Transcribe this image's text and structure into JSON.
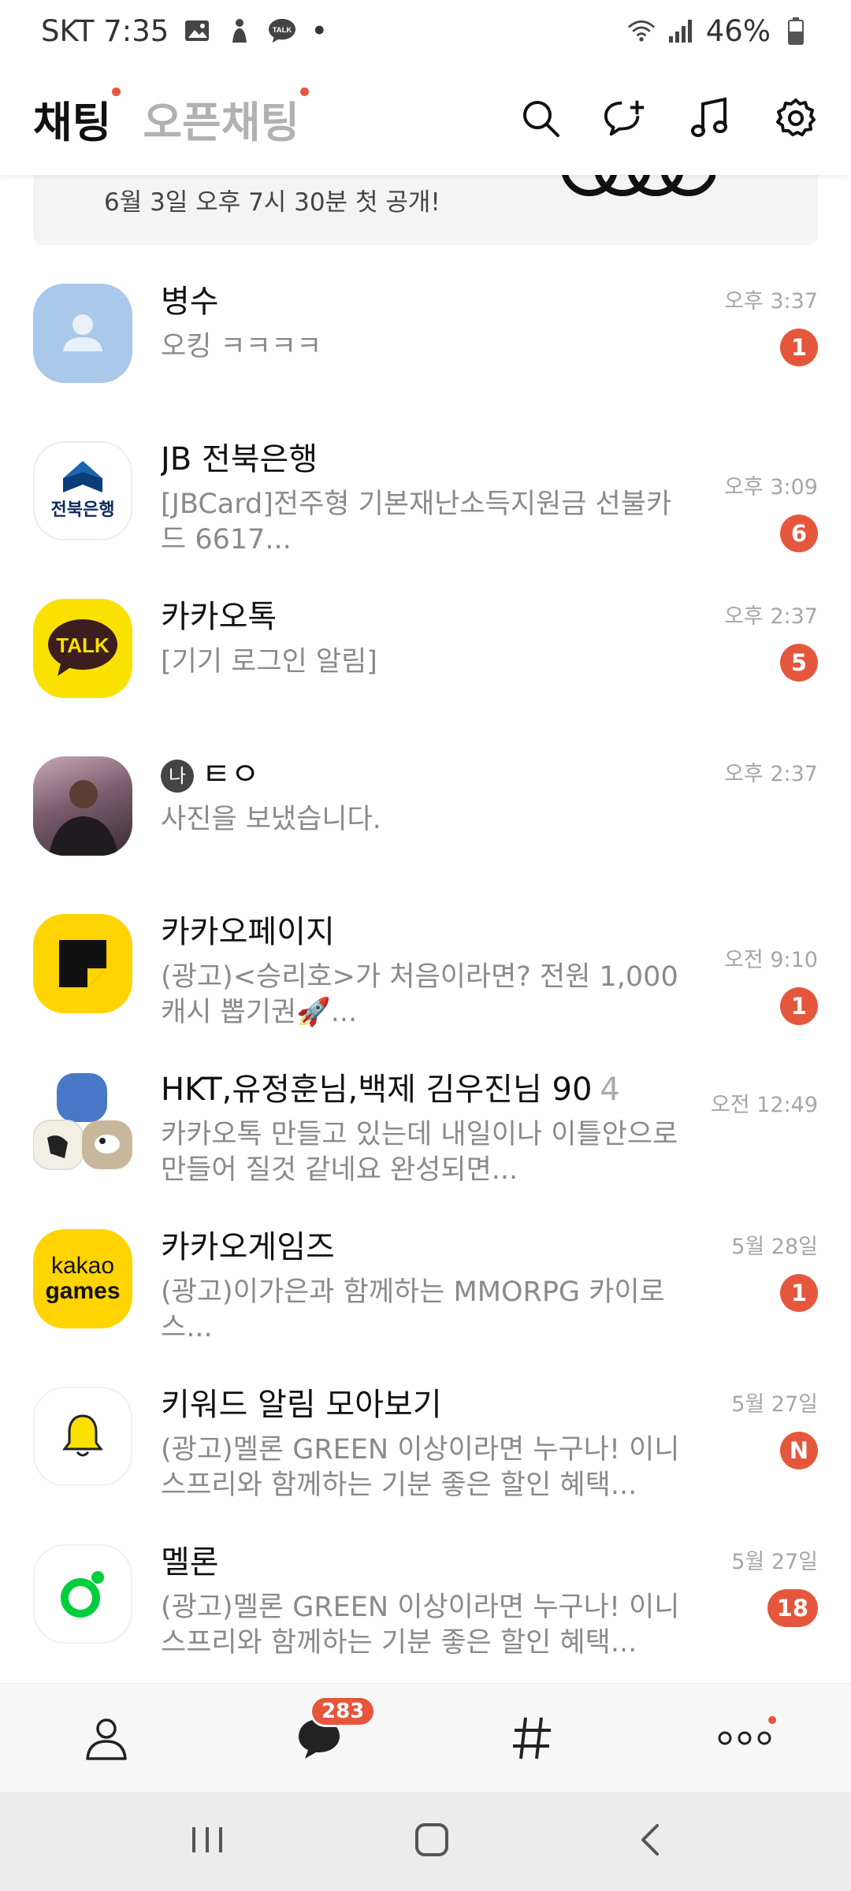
{
  "status_bar": {
    "carrier_time": "SKT 7:35",
    "notif_talk": "TALK",
    "dot": "•",
    "battery": "46%"
  },
  "header": {
    "tabs": [
      {
        "label": "채팅",
        "active": true
      },
      {
        "label": "오픈채팅",
        "active": false
      }
    ],
    "icons": [
      "search-icon",
      "new-chat-icon",
      "music-icon",
      "settings-icon"
    ]
  },
  "banner": {
    "text": "6월 3일 오후 7시 30분 첫 공개!"
  },
  "chats": [
    {
      "name": "병수",
      "count": "",
      "preview": "오킹 ㅋㅋㅋㅋ",
      "time": "오후 3:37",
      "badge": "1"
    },
    {
      "name": "JB 전북은행",
      "count": "",
      "preview": "[JBCard]전주형 기본재난소득지원금 선불카드 6617...",
      "time": "오후 3:09",
      "badge": "6",
      "avatar_text": "전북은행"
    },
    {
      "name": "카카오톡",
      "count": "",
      "preview": "[기기 로그인 알림]",
      "time": "오후 2:37",
      "badge": "5",
      "avatar_text": "TALK"
    },
    {
      "name": "ㅌㅇ",
      "count": "",
      "preview": "사진을 보냈습니다.",
      "time": "오후 2:37",
      "badge": "",
      "prefix": "나"
    },
    {
      "name": "카카오페이지",
      "count": "",
      "preview": "(광고)<승리호>가 처음이라면? 전원 1,000캐시 뽑기권🚀...",
      "time": "오전 9:10",
      "badge": "1"
    },
    {
      "name": "HKT,유정훈님,백제 김우진님 90",
      "count": "4",
      "preview": "카카오톡 만들고 있는데 내일이나 이틀안으로 만들어 질것 같네요 완성되면...",
      "time": "오전 12:49",
      "badge": ""
    },
    {
      "name": "카카오게임즈",
      "count": "",
      "preview": "(광고)이가은과 함께하는 MMORPG 카이로스...",
      "time": "5월 28일",
      "badge": "1",
      "avatar_text_1": "kakao",
      "avatar_text_2": "games"
    },
    {
      "name": "키워드 알림 모아보기",
      "count": "",
      "preview": "(광고)멜론 GREEN 이상이라면 누구나! 이니스프리와 함께하는 기분 좋은 할인 혜택...",
      "time": "5월 27일",
      "badge": "N"
    },
    {
      "name": "멜론",
      "count": "",
      "preview": "(광고)멜론 GREEN 이상이라면 누구나! 이니스프리와 함께하는 기분 좋은 할인 혜택...",
      "time": "5월 27일",
      "badge": "18"
    }
  ],
  "bottom_nav": {
    "chat_badge": "283",
    "items": [
      "friends-icon",
      "chat-icon",
      "hashtag-icon",
      "more-icon"
    ]
  },
  "colors": {
    "accent": "#e4573d",
    "kakao_yellow": "#fae100"
  }
}
